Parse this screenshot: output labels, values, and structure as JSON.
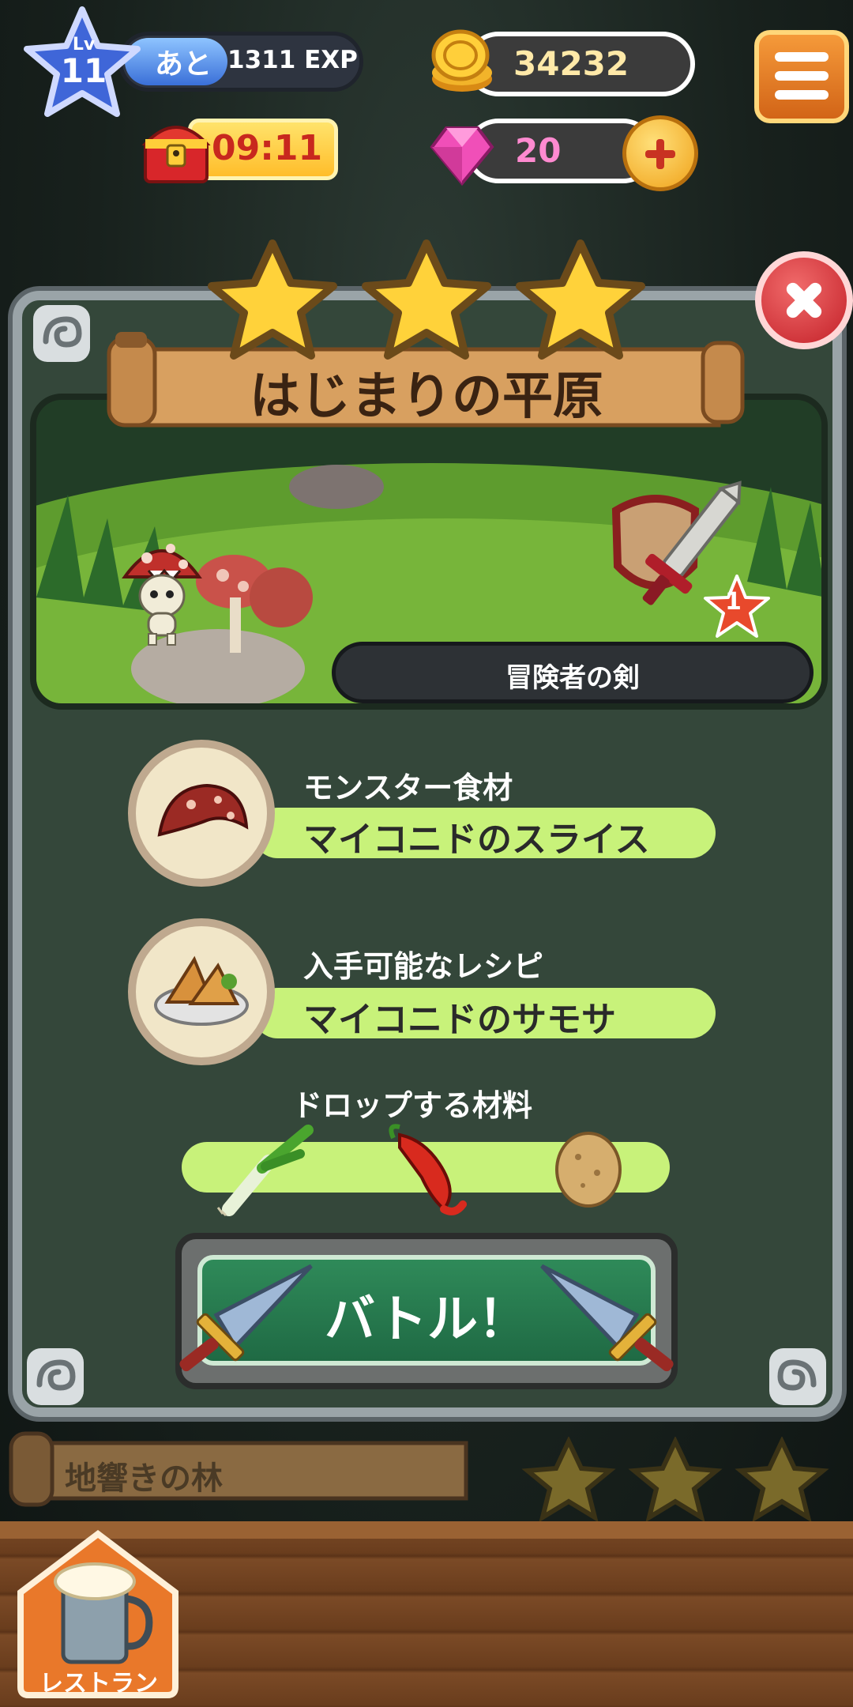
{
  "hud": {
    "level_prefix": "Lv",
    "level": "11",
    "exp_prefix": "あと",
    "exp_value": "1311 EXP",
    "coins": "34232",
    "timer": "09:11",
    "gems": "20"
  },
  "stage": {
    "title": "はじまりの平原",
    "stars_earned": 3,
    "weapon_name": "冒険者の剣",
    "weapon_level": "1"
  },
  "rewards": [
    {
      "label": "モンスター食材",
      "value": "マイコニドのスライス"
    },
    {
      "label": "入手可能なレシピ",
      "value": "マイコニドのサモサ"
    }
  ],
  "drops": {
    "label": "ドロップする材料"
  },
  "battle": {
    "label": "バトル！"
  },
  "next_stage": {
    "title": "地響きの林"
  },
  "restaurant": {
    "label": "レストラン"
  },
  "colors": {
    "panel": "#34473a",
    "accent_green": "#c8f27a",
    "battle_green": "#2f8a59",
    "close_red": "#c32028",
    "star_yellow": "#ffd23a"
  }
}
